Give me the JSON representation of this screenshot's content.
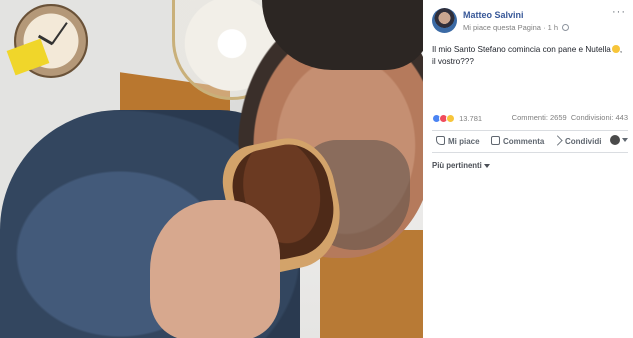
{
  "post": {
    "author": "Matteo Salvini",
    "page_like": "Mi piace questa Pagina",
    "separator": "·",
    "time": "1 h",
    "more": "···",
    "text": "Il mio Santo Stefano comincia con pane e Nutella",
    "text_end": ", il vostro???"
  },
  "stats": {
    "reactions_count": "13.781",
    "comments": "Commenti: 2659",
    "shares": "Condivisioni: 443"
  },
  "actions": {
    "like": "Mi piace",
    "comment": "Commenta",
    "share": "Condividi"
  },
  "filter": {
    "label": "Più pertinenti"
  },
  "icons": [
    "globe-icon",
    "more-icon",
    "like-icon",
    "comment-icon",
    "share-icon",
    "caret-down-icon"
  ],
  "colors": {
    "author_link": "#385898",
    "like_reaction": "#4b84f3",
    "love_reaction": "#f04c5d",
    "haha_reaction": "#f7c53a"
  }
}
